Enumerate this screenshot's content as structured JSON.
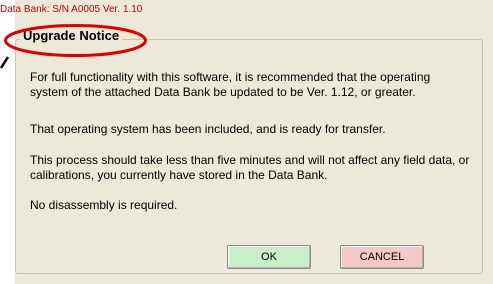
{
  "header": {
    "title": "Data Bank:  S/N A0005  Ver. 1.10"
  },
  "notice": {
    "title": "Upgrade Notice",
    "paragraphs": [
      "For full functionality with this software, it is recommended that the operating system of the attached Data Bank be updated to be Ver. 1.12, or greater.",
      "That operating system has been included, and is ready for transfer.",
      "This process should take less than five minutes and will not affect any field data, or calibrations, you currently have stored in the Data Bank.",
      "No disassembly is required."
    ]
  },
  "buttons": {
    "ok_label": "OK",
    "cancel_label": "CANCEL"
  },
  "colors": {
    "header_text": "#cc0000",
    "highlight_ellipse": "#e00000",
    "ok_button": "#c8f0c8",
    "cancel_button": "#f6c8c8",
    "panel_background": "#ece9d8"
  }
}
